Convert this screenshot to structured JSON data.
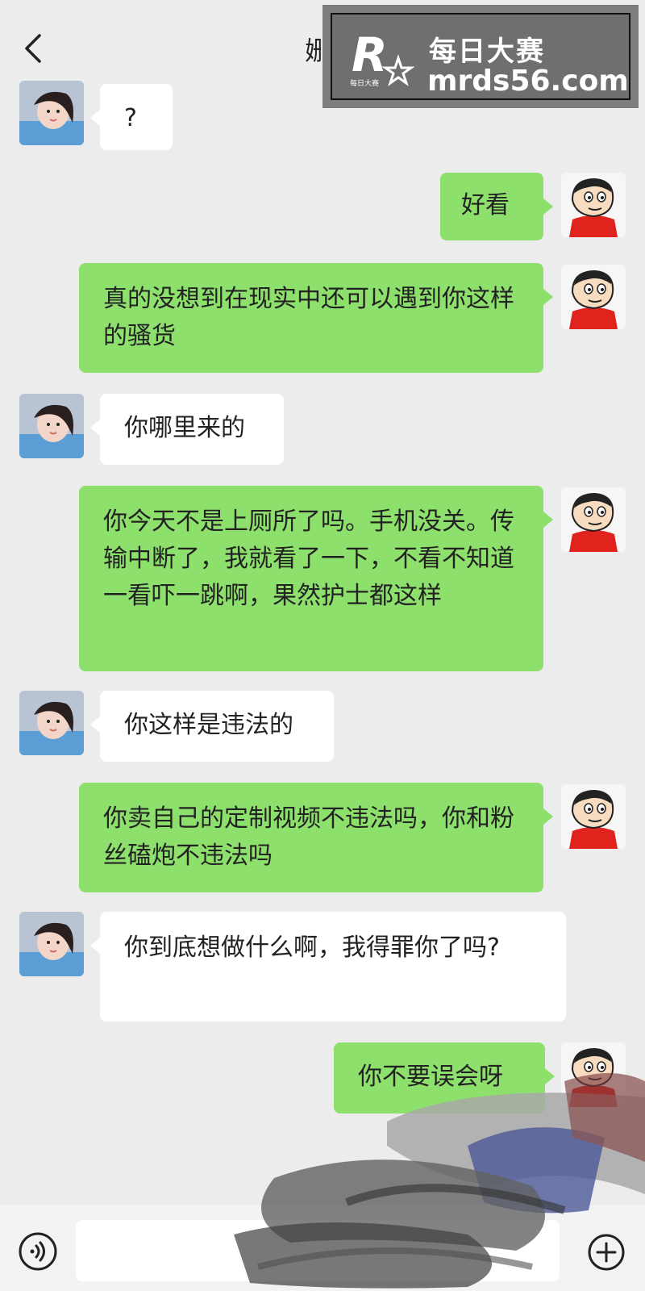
{
  "header": {
    "title": "姗",
    "back_icon": "chevron-left-icon",
    "more_icon": "more-dots-icon"
  },
  "watermark": {
    "logo_letter": "R",
    "logo_small": "每日大赛",
    "cn_text": "每日大赛",
    "url_text": "mrds56.com"
  },
  "messages": [
    {
      "side": "left",
      "text": "?"
    },
    {
      "side": "right",
      "text": "好看"
    },
    {
      "side": "right",
      "text": "真的没想到在现实中还可以遇到你这样的骚货"
    },
    {
      "side": "left",
      "text": "你哪里来的"
    },
    {
      "side": "right",
      "text": "你今天不是上厕所了吗。手机没关。传输中断了，我就看了一下，不看不知道一看吓一跳啊，果然护士都这样"
    },
    {
      "side": "left",
      "text": "你这样是违法的"
    },
    {
      "side": "right",
      "text": "你卖自己的定制视频不违法吗，你和粉丝磕炮不违法吗"
    },
    {
      "side": "left",
      "text": "你到底想做什么啊，我得罪你了吗?"
    },
    {
      "side": "right",
      "text": "你不要误会呀"
    }
  ],
  "input_bar": {
    "voice_icon": "voice-icon",
    "plus_icon": "plus-icon"
  },
  "colors": {
    "background": "#ececec",
    "right_bubble": "#8ee06c",
    "left_bubble": "#ffffff"
  }
}
